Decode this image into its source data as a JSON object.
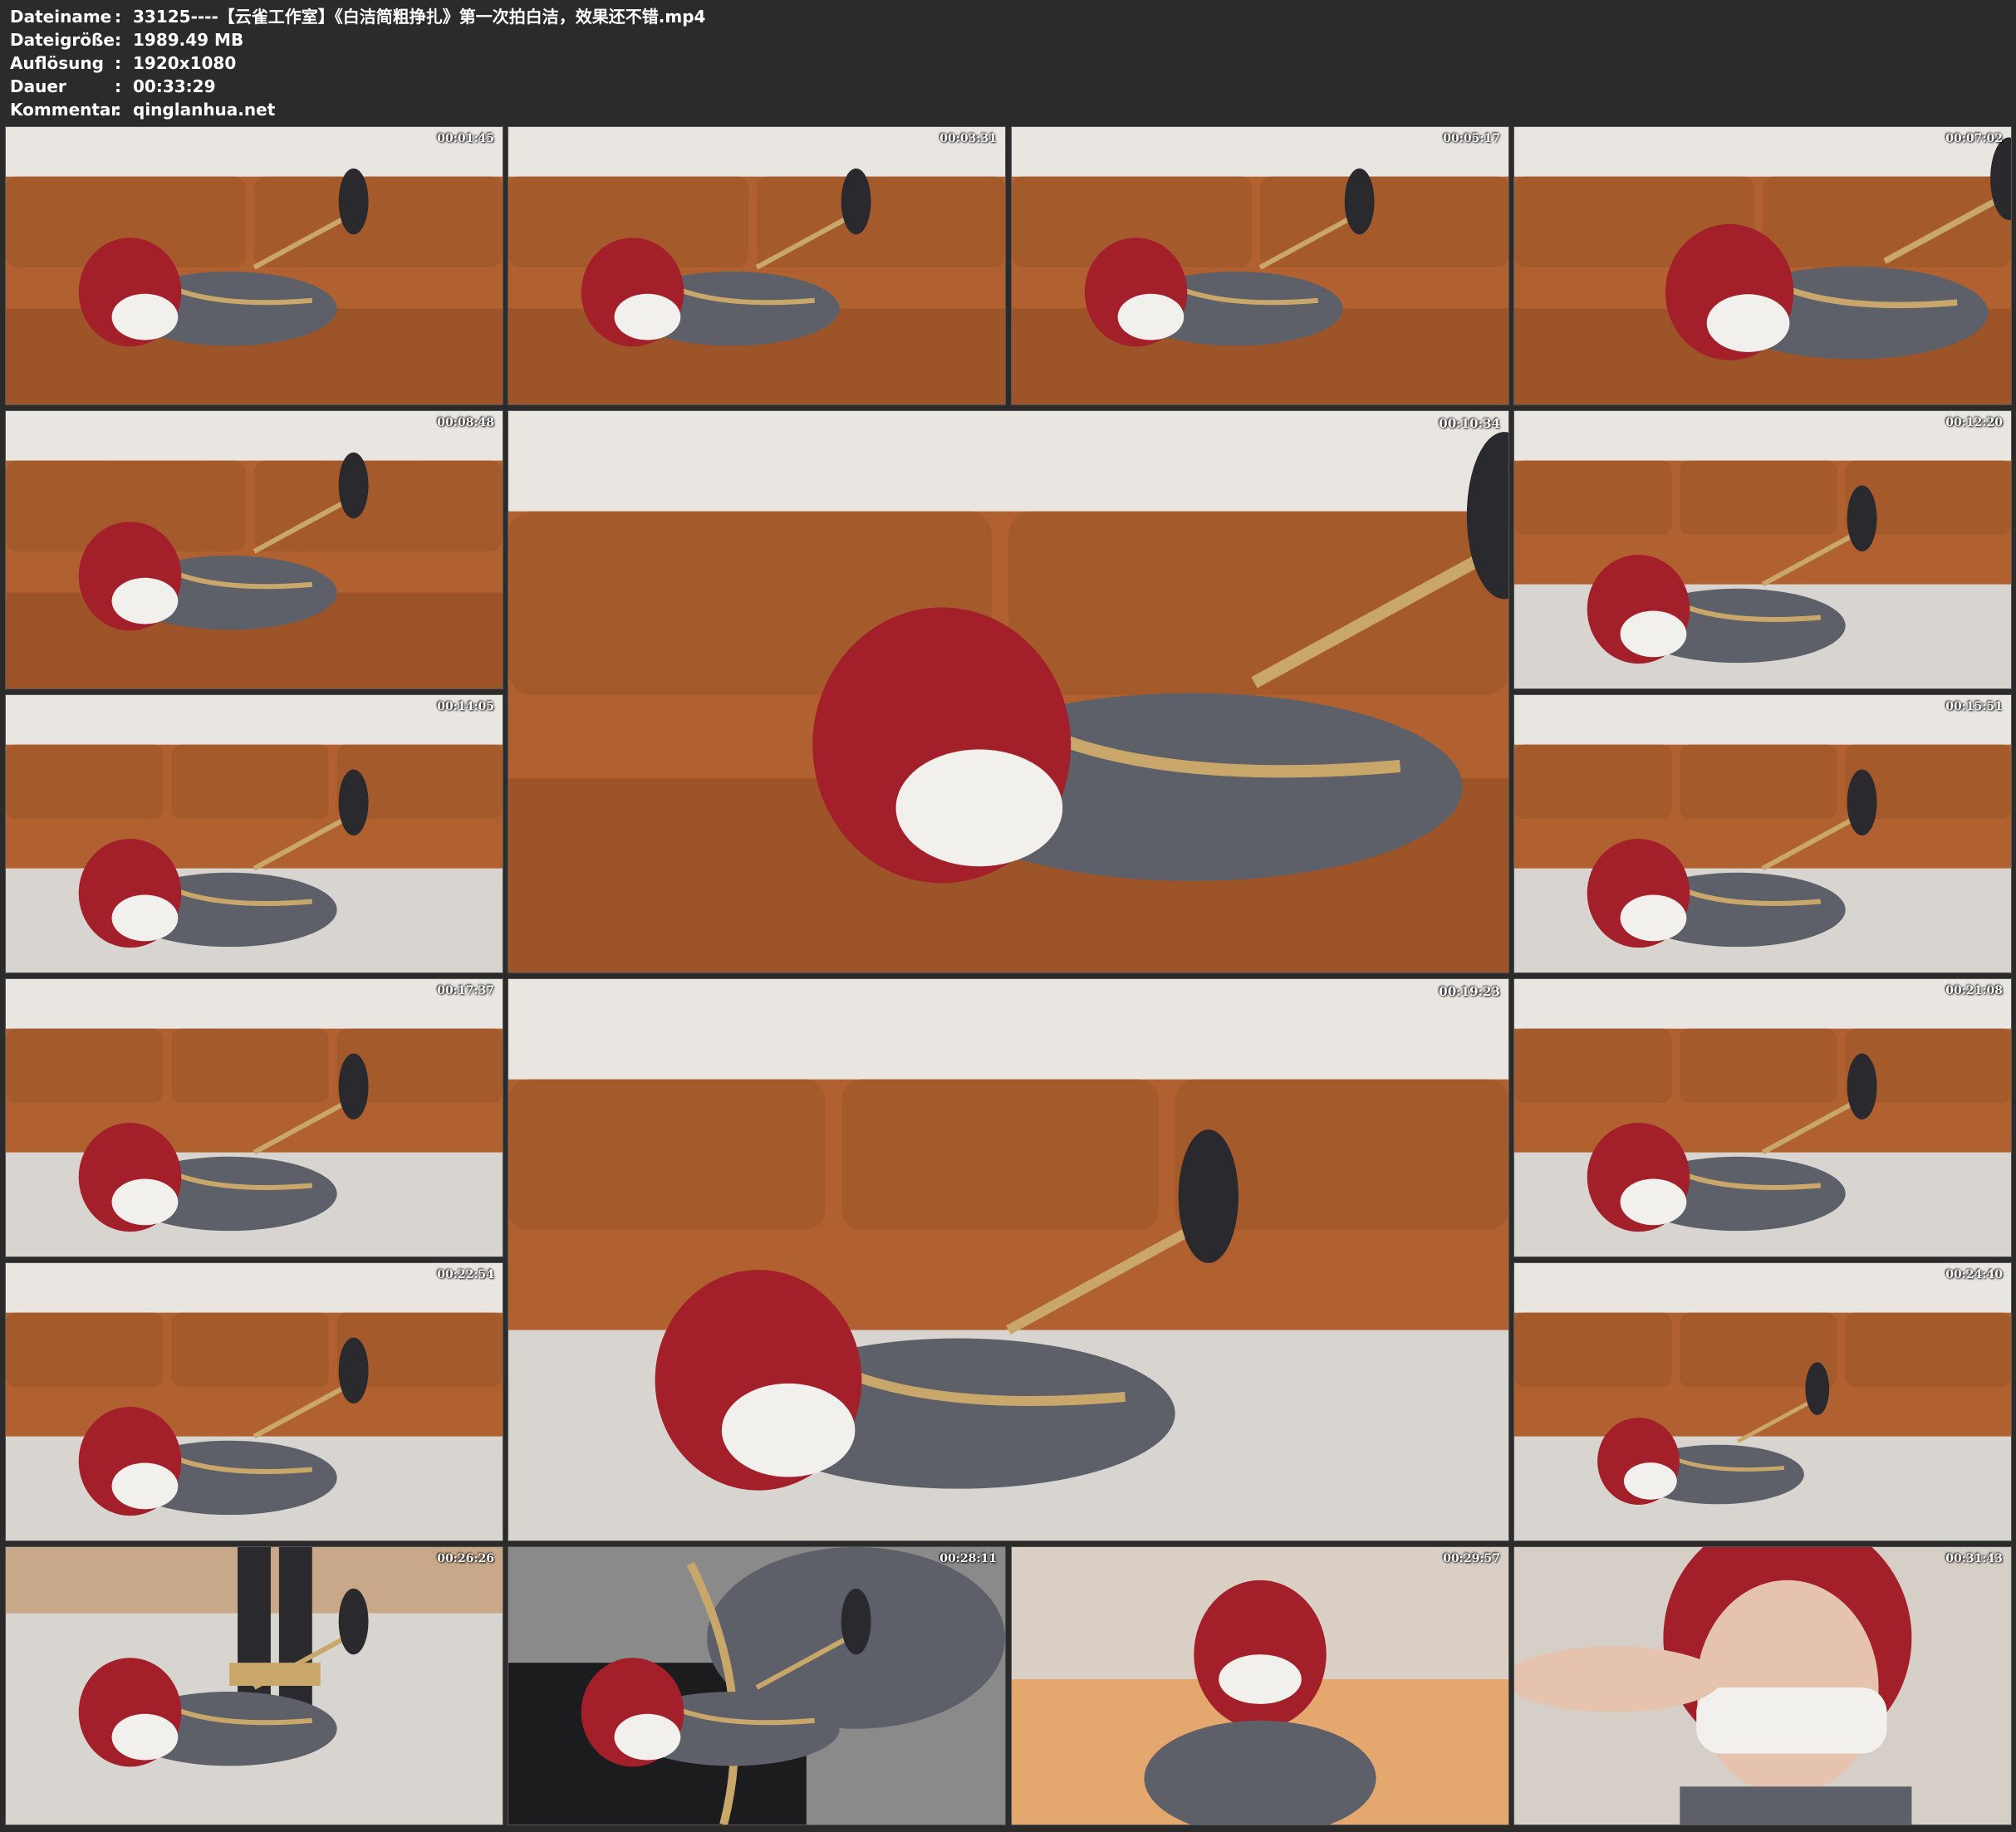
{
  "info": [
    {
      "key": "Dateiname",
      "value": "33125----【云雀工作室】《白洁简粗挣扎》第一次拍白洁，效果还不错.mp4"
    },
    {
      "key": "Dateigröße",
      "value": "1989.49 MB"
    },
    {
      "key": "Auflösung",
      "value": "1920x1080"
    },
    {
      "key": "Dauer",
      "value": "00:33:29"
    },
    {
      "key": "Kommentar",
      "value": "qinglanhua.net"
    }
  ],
  "separator": ":",
  "thumbnails": [
    {
      "time": "00:01:45",
      "scene": "sofa"
    },
    {
      "time": "00:03:31",
      "scene": "sofa"
    },
    {
      "time": "00:05:17",
      "scene": "sofa"
    },
    {
      "time": "00:07:02",
      "scene": "sofa-close"
    },
    {
      "time": "00:08:48",
      "scene": "sofa"
    },
    {
      "time": "00:10:34",
      "scene": "sofa-close"
    },
    {
      "time": "00:12:20",
      "scene": "floor"
    },
    {
      "time": "00:14:05",
      "scene": "floor"
    },
    {
      "time": "00:15:51",
      "scene": "floor"
    },
    {
      "time": "00:17:37",
      "scene": "floor"
    },
    {
      "time": "00:19:23",
      "scene": "floor"
    },
    {
      "time": "00:21:08",
      "scene": "floor"
    },
    {
      "time": "00:22:54",
      "scene": "floor"
    },
    {
      "time": "00:24:40",
      "scene": "floor-sit"
    },
    {
      "time": "00:26:26",
      "scene": "feet"
    },
    {
      "time": "00:28:11",
      "scene": "closeup"
    },
    {
      "time": "00:29:57",
      "scene": "bed"
    },
    {
      "time": "00:31:43",
      "scene": "face"
    }
  ],
  "colors": {
    "background": "#2b2b2b",
    "sofa": "#b0612f",
    "wall": "#e9e6e2",
    "floor": "#d8d4cf",
    "hair": "#a3202a",
    "shirt": "#5d6068",
    "rope": "#c9a76a"
  }
}
